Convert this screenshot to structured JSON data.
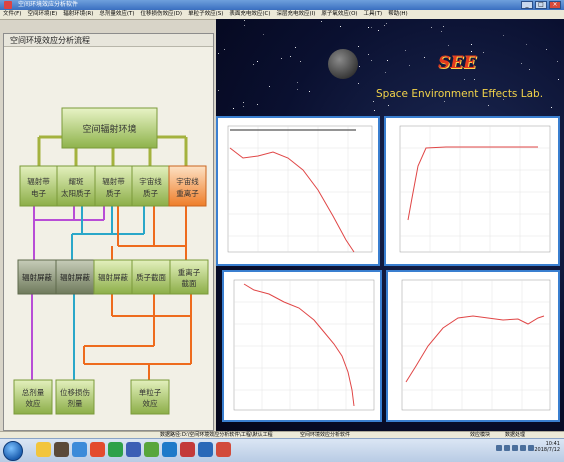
{
  "window": {
    "title": "空间环境效应分析软件",
    "buttons": [
      "_",
      "□",
      "×"
    ]
  },
  "menu": [
    "文件(F)",
    "空间环境(E)",
    "辐射环境(R)",
    "总剂量效应(T)",
    "位移损伤效应(D)",
    "单粒子效应(S)",
    "表面充电效应(C)",
    "深层充电效应(I)",
    "原子氧效应(O)",
    "工具(T)",
    "帮助(H)"
  ],
  "flowchart": {
    "panel_title": "空间环境效应分析流程",
    "root": "空间辐射环境",
    "sources": [
      {
        "id": "belt-electron",
        "lines": [
          "辐射带",
          "电子"
        ]
      },
      {
        "id": "solar-proton",
        "lines": [
          "耀斑",
          "太阳质子"
        ]
      },
      {
        "id": "belt-proton",
        "lines": [
          "辐射带",
          "质子"
        ]
      },
      {
        "id": "cosmic-proton",
        "lines": [
          "宇宙线",
          "质子"
        ]
      },
      {
        "id": "cosmic-heavy-ion",
        "lines": [
          "宇宙线",
          "重离子"
        ]
      }
    ],
    "middle": [
      {
        "id": "shield-1",
        "lines": [
          "辐射屏蔽"
        ]
      },
      {
        "id": "shield-2",
        "lines": [
          "辐射屏蔽"
        ]
      },
      {
        "id": "shield-3",
        "lines": [
          "辐射屏蔽"
        ]
      },
      {
        "id": "nuclear-cross-section",
        "lines": [
          "质子截面"
        ]
      },
      {
        "id": "heavy-ion-cross-section",
        "lines": [
          "重离子",
          "截面"
        ]
      }
    ],
    "effects": [
      {
        "id": "total-dose",
        "lines": [
          "总剂量",
          "效应"
        ]
      },
      {
        "id": "displacement",
        "lines": [
          "位移损伤",
          "剂量"
        ]
      },
      {
        "id": "single-event",
        "lines": [
          "单粒子",
          "效应"
        ]
      }
    ],
    "colors": {
      "top_box": "#a9c56a",
      "source_box": "#a3c064",
      "highlight_box": "#f08a3a",
      "gray_box": "#8e9a7a",
      "olive_line": "#a4b23e",
      "magenta_line": "#b84dd6",
      "cyan_line": "#2aa7c9",
      "orange_line": "#ee6b1d"
    }
  },
  "banner": {
    "logo": "SEE",
    "lab_name": "Space Environment Effects Lab."
  },
  "charts": [
    {
      "id": "chart-top-left",
      "title": "",
      "type": "line"
    },
    {
      "id": "chart-top-right",
      "title": "",
      "type": "line"
    },
    {
      "id": "chart-bottom-left",
      "title": "",
      "type": "line"
    },
    {
      "id": "chart-bottom-right",
      "title": "",
      "type": "line"
    }
  ],
  "statusbar": {
    "left": "数据路径:",
    "path": "D:\\空间环境效应分析软件\\工程\\默认工程",
    "mid": "空间环境效应分析软件",
    "right1": "效应模块",
    "right2": "数据处理"
  },
  "taskbar": {
    "time": "10:41",
    "date": "2018/7/12"
  }
}
